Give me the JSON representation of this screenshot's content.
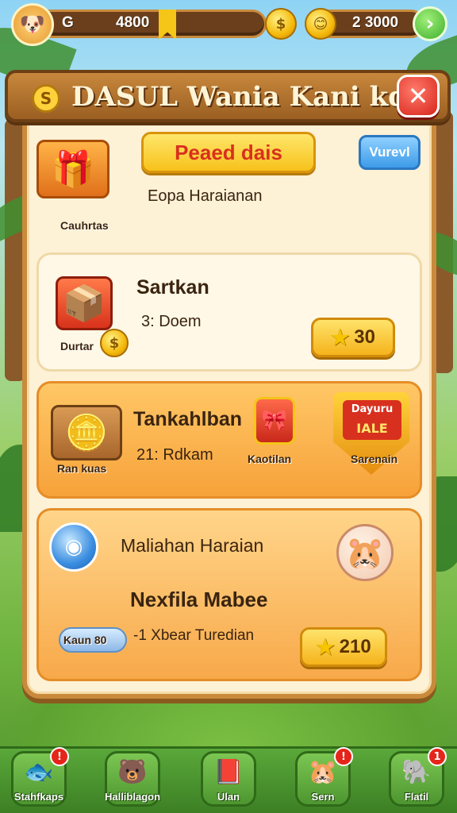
{
  "hud": {
    "level": "G",
    "coins": "4800",
    "gems": "2 3000",
    "coin_symbol": "$",
    "plus_symbol": "›"
  },
  "header": {
    "title": "DASUL Wania  Kani kd",
    "badge": "S",
    "close_symbol": "✕"
  },
  "section1": {
    "chest_caption": "Cauhrtas",
    "banner": "Peaed dais",
    "button": "Vurevl",
    "subtitle": "Eopa Haraianan"
  },
  "section2": {
    "chest_caption": "Durtar",
    "title": "Sartkan",
    "detail": "3: Doem",
    "reward": "30"
  },
  "section3": {
    "chest_caption": "Ran kuas",
    "title": "Tankahlban",
    "detail": "21: Rdkam",
    "item1_caption": "Kaotilan",
    "item2_caption": "Sarenain",
    "sign_top": "Dayuru",
    "sign_bottom": "IALE"
  },
  "section4": {
    "title": "Maliahan Haraian",
    "subtitle": "Nexfila Mabee",
    "pill_caption": "Kaun 80",
    "detail": "-1 Xbear Turedian",
    "reward": "210"
  },
  "nav": {
    "items": [
      {
        "label": "Stahfkaps",
        "icon": "🐟",
        "badge": "!"
      },
      {
        "label": "Halliblagon",
        "icon": "🐻",
        "badge": ""
      },
      {
        "label": "Ulan",
        "icon": "📕",
        "badge": ""
      },
      {
        "label": "Sern",
        "icon": "🐹",
        "badge": "!"
      },
      {
        "label": "Flatil",
        "icon": "🐘",
        "badge": "1"
      }
    ]
  },
  "colors": {
    "panel_border": "#c98a3c",
    "accent_yellow": "#f7c21b",
    "close_red": "#d8251b",
    "nav_green": "#4d9630"
  }
}
